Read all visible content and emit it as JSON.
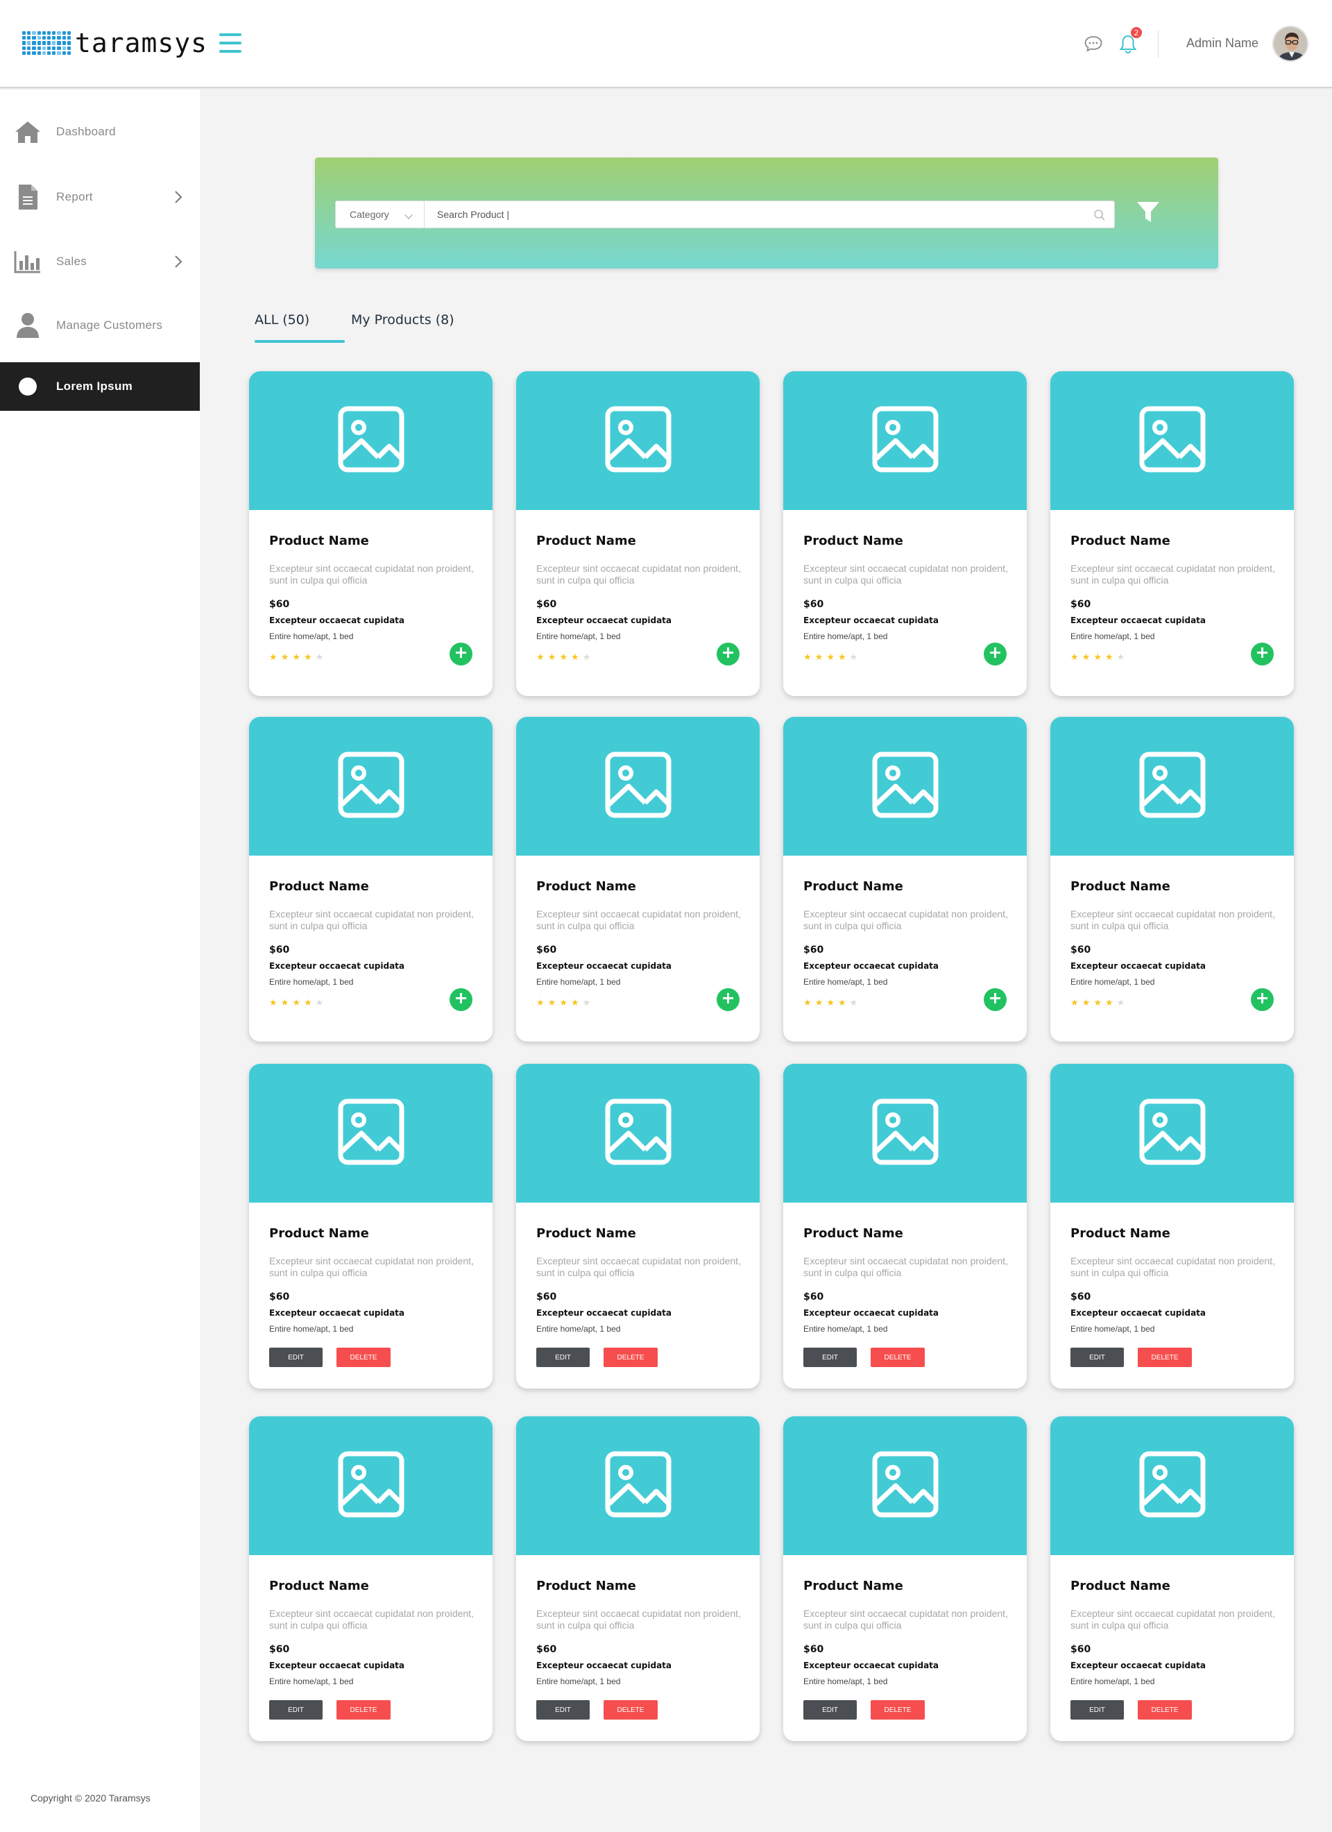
{
  "app": {
    "brand": "taramsys",
    "admin_name": "Admin Name",
    "notification_count": "2",
    "copyright": "Copyright © 2020 Taramsys",
    "accent_color": "#3fc3cf",
    "active_nav_color": "#202020"
  },
  "sidebar": {
    "items": [
      {
        "label": "Dashboard",
        "icon": "home-icon"
      },
      {
        "label": "Report",
        "icon": "document-icon"
      },
      {
        "label": "Sales",
        "icon": "bar-chart-icon"
      },
      {
        "label": "Manage Customers",
        "icon": "user-icon"
      },
      {
        "label": "Lorem Ipsum",
        "icon": "circle-icon",
        "active": true
      }
    ]
  },
  "search": {
    "category_label": "Category",
    "placeholder": "Search Product |"
  },
  "tabs": {
    "all": "ALL (50)",
    "my": "My Products (8)"
  },
  "card": {
    "name": "Product Name",
    "description": "Excepteur sint occaecat cupidatat non proident, sunt in culpa qui officia",
    "price": "$60",
    "subtitle": "Excepteur occaecat cupidata",
    "type": "Entire home/apt, 1 bed",
    "rating": 4,
    "rating_max": 5,
    "edit_label": "EDIT",
    "delete_label": "DELETE"
  },
  "grid": {
    "rows": [
      {
        "mode": "add"
      },
      {
        "mode": "add"
      },
      {
        "mode": "manage"
      },
      {
        "mode": "manage"
      }
    ],
    "columns": 4
  }
}
